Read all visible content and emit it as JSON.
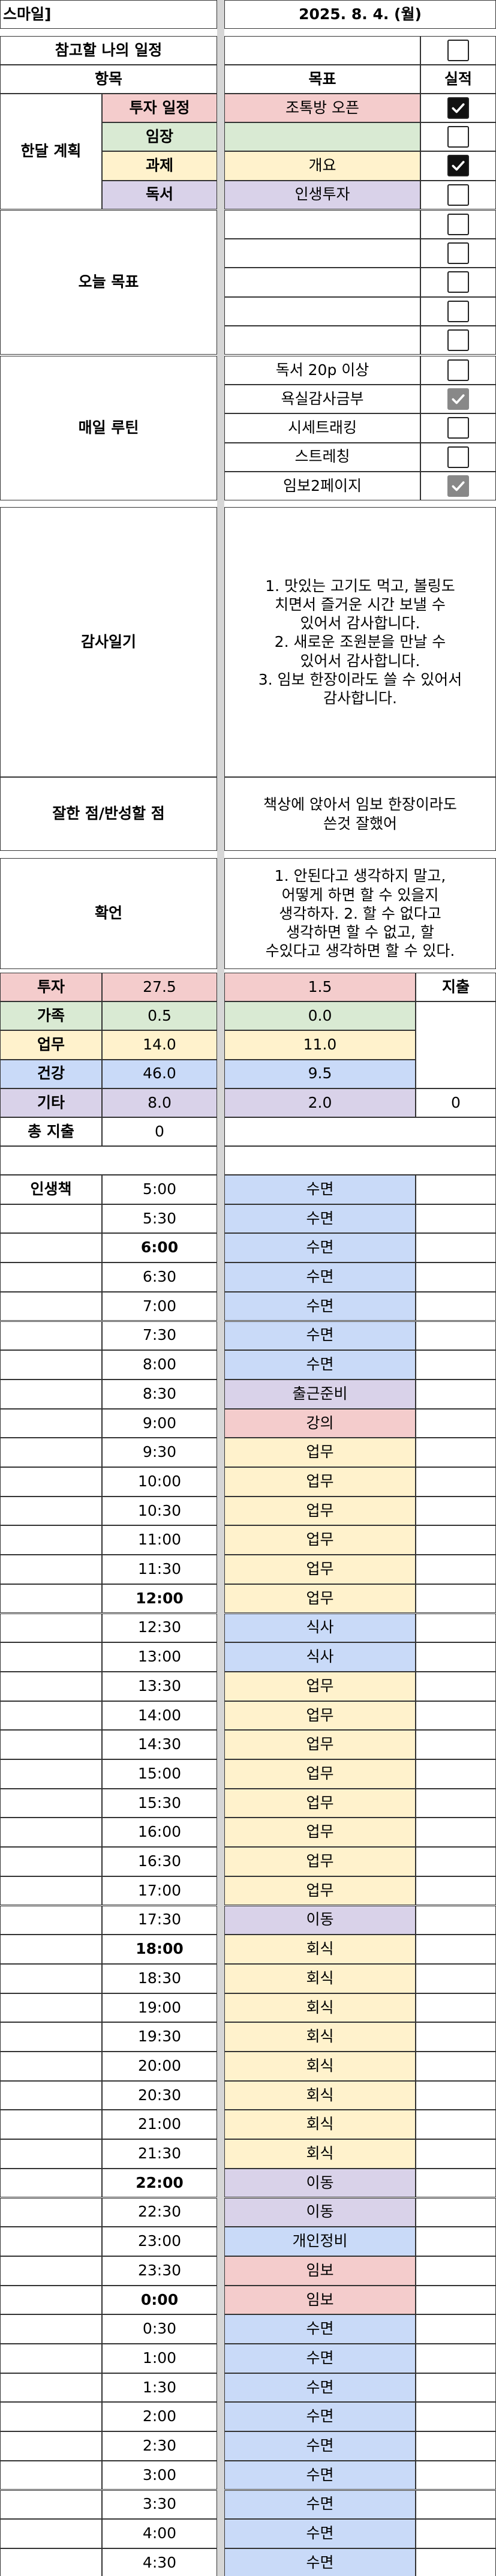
{
  "header": {
    "app_label": "스마일]",
    "date": "2025. 8. 4. (월)"
  },
  "reference_label": "참고할 나의 일정",
  "colors": {
    "pink": "#f4cccc",
    "green": "#d9ead3",
    "yellow": "#fff2cc",
    "blue": "#c9daf8",
    "purple": "#d9d2e9",
    "gap": "#d6d6d6"
  },
  "table_header": {
    "item": "항목",
    "goal": "목표",
    "result": "실적"
  },
  "monthly_plan": {
    "label": "한달 계획",
    "rows": [
      {
        "label": "투자 일정",
        "goal": "조톡방 오픈",
        "checked": true
      },
      {
        "label": "임장",
        "goal": "",
        "checked": false
      },
      {
        "label": "과제",
        "goal": "개요",
        "checked": true
      },
      {
        "label": "독서",
        "goal": "인생투자",
        "checked": false
      }
    ]
  },
  "today_goals": {
    "label": "오늘 목표",
    "rows": [
      "",
      "",
      "",
      "",
      ""
    ]
  },
  "daily_routine": {
    "label": "매일 루틴",
    "rows": [
      {
        "text": "독서 20p 이상",
        "checked": false
      },
      {
        "text": "욕실감사금부",
        "checked": true
      },
      {
        "text": "시세트래킹",
        "checked": false
      },
      {
        "text": "스트레칭",
        "checked": false
      },
      {
        "text": "임보2페이지",
        "checked": true
      }
    ]
  },
  "gratitude": {
    "label": "감사일기",
    "lines": [
      "1. 맛있는 고기도 먹고, 볼링도",
      "치면서 즐거운 시간 보낼 수",
      "있어서 감사합니다.",
      "2. 새로운 조원분을 만날 수",
      "있어서 감사합니다.",
      "3. 임보 한장이라도 쓸 수 있어서",
      "감사합니다."
    ]
  },
  "reflection": {
    "label": "잘한 점/반성할 점",
    "lines": [
      "책상에 앉아서 임보 한장이라도",
      "쓴것 잘했어"
    ]
  },
  "affirmation": {
    "label": "확언",
    "lines": [
      "1. 안된다고 생각하지 말고,",
      "어떻게 하면 할 수 있을지",
      "생각하자. 2. 할 수 없다고",
      "생각하면 할 수 없고, 할",
      "수있다고 생각하면 할 수 있다."
    ]
  },
  "time_summary": {
    "rows": [
      {
        "label": "투자",
        "value": "27.5",
        "goal": "1.5"
      },
      {
        "label": "가족",
        "value": "0.5",
        "goal": "0.0"
      },
      {
        "label": "업무",
        "value": "14.0",
        "goal": "11.0"
      },
      {
        "label": "건강",
        "value": "46.0",
        "goal": "9.5"
      },
      {
        "label": "기타",
        "value": "8.0",
        "goal": "2.0"
      }
    ],
    "expense_label": "지출",
    "expense_value": "0",
    "total_expense_label": "총 지출",
    "total_expense_value": "0"
  },
  "schedule": {
    "section_label": "인생책",
    "slots": [
      {
        "time": "5:00",
        "activity": "수면"
      },
      {
        "time": "5:30",
        "activity": "수면"
      },
      {
        "time": "6:00",
        "activity": "수면"
      },
      {
        "time": "6:30",
        "activity": "수면"
      },
      {
        "time": "7:00",
        "activity": "수면"
      },
      {
        "time": "7:30",
        "activity": "수면"
      },
      {
        "time": "8:00",
        "activity": "수면"
      },
      {
        "time": "8:30",
        "activity": "출근준비"
      },
      {
        "time": "9:00",
        "activity": "강의"
      },
      {
        "time": "9:30",
        "activity": "업무"
      },
      {
        "time": "10:00",
        "activity": "업무"
      },
      {
        "time": "10:30",
        "activity": "업무"
      },
      {
        "time": "11:00",
        "activity": "업무"
      },
      {
        "time": "11:30",
        "activity": "업무"
      },
      {
        "time": "12:00",
        "activity": "업무"
      },
      {
        "time": "12:30",
        "activity": "식사"
      },
      {
        "time": "13:00",
        "activity": "식사"
      },
      {
        "time": "13:30",
        "activity": "업무"
      },
      {
        "time": "14:00",
        "activity": "업무"
      },
      {
        "time": "14:30",
        "activity": "업무"
      },
      {
        "time": "15:00",
        "activity": "업무"
      },
      {
        "time": "15:30",
        "activity": "업무"
      },
      {
        "time": "16:00",
        "activity": "업무"
      },
      {
        "time": "16:30",
        "activity": "업무"
      },
      {
        "time": "17:00",
        "activity": "업무"
      },
      {
        "time": "17:30",
        "activity": "이동"
      },
      {
        "time": "18:00",
        "activity": "회식"
      },
      {
        "time": "18:30",
        "activity": "회식"
      },
      {
        "time": "19:00",
        "activity": "회식"
      },
      {
        "time": "19:30",
        "activity": "회식"
      },
      {
        "time": "20:00",
        "activity": "회식"
      },
      {
        "time": "20:30",
        "activity": "회식"
      },
      {
        "time": "21:00",
        "activity": "회식"
      },
      {
        "time": "21:30",
        "activity": "회식"
      },
      {
        "time": "22:00",
        "activity": "이동"
      },
      {
        "time": "22:30",
        "activity": "이동"
      },
      {
        "time": "23:00",
        "activity": "개인정비"
      },
      {
        "time": "23:30",
        "activity": "임보"
      },
      {
        "time": "0:00",
        "activity": "임보"
      },
      {
        "time": "0:30",
        "activity": "수면"
      },
      {
        "time": "1:00",
        "activity": "수면"
      },
      {
        "time": "1:30",
        "activity": "수면"
      },
      {
        "time": "2:00",
        "activity": "수면"
      },
      {
        "time": "2:30",
        "activity": "수면"
      },
      {
        "time": "3:00",
        "activity": "수면"
      },
      {
        "time": "3:30",
        "activity": "수면"
      },
      {
        "time": "4:00",
        "activity": "수면"
      },
      {
        "time": "4:30",
        "activity": "수면"
      }
    ]
  }
}
